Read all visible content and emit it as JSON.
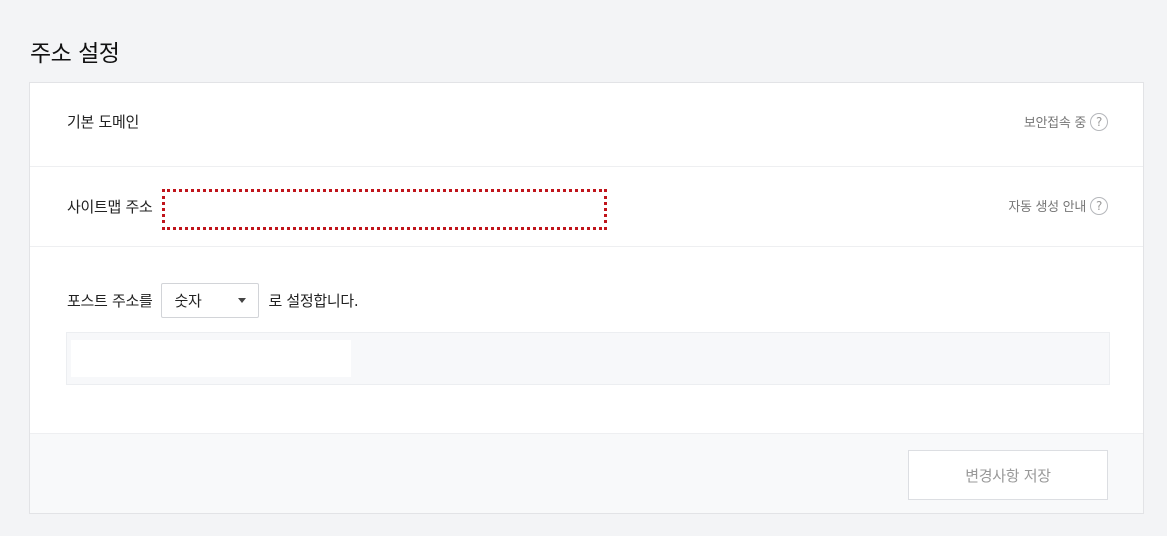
{
  "page_title": "주소 설정",
  "domain": {
    "label": "기본 도메인",
    "secure_text": "보안접속 중",
    "help_symbol": "?"
  },
  "sitemap": {
    "label": "사이트맵 주소",
    "guide_text": "자동 생성 안내",
    "help_symbol": "?",
    "highlight_color": "#c0141b"
  },
  "post": {
    "prefix": "포스트 주소를",
    "selected": "숫자",
    "suffix": "로 설정합니다."
  },
  "footer": {
    "save_label": "변경사항 저장"
  }
}
